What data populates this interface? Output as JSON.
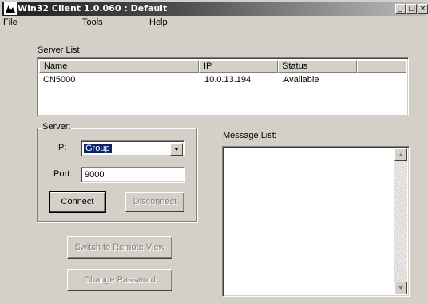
{
  "window": {
    "title": "Win32 Client 1.0.060 : Default",
    "controls": {
      "minimize": "_",
      "maximize": "□",
      "close": "×"
    }
  },
  "menu": {
    "items": [
      "File",
      "Tools",
      "Help"
    ]
  },
  "server_list": {
    "label": "Server List",
    "columns": [
      "Name",
      "IP",
      "Status"
    ],
    "rows": [
      {
        "name": "CN5000",
        "ip": "10.0.13.194",
        "status": "Available"
      }
    ]
  },
  "server": {
    "group_label": "Server:",
    "ip_label": "IP:",
    "ip_value": "Group",
    "port_label": "Port:",
    "port_value": "9000",
    "connect_label": "Connect",
    "disconnect_label": "Disconnect"
  },
  "actions": {
    "switch_label": "Switch to Remote View",
    "change_password_label": "Change Password"
  },
  "message_list": {
    "label": "Message List:"
  },
  "icons": {
    "app": "app-icon",
    "combo_arrow": "chevron-down-icon",
    "scroll_up": "scroll-up-icon",
    "scroll_down": "scroll-down-icon"
  }
}
